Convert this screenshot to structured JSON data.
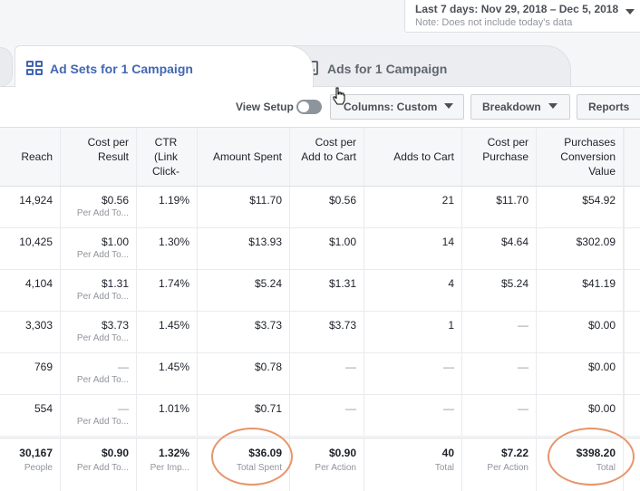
{
  "date_range": {
    "label": "Last 7 days: Nov 29, 2018 – Dec 5, 2018",
    "note": "Note: Does not include today's data"
  },
  "tabs": [
    {
      "label": "Ad Sets for 1 Campaign",
      "icon": "grid-icon",
      "active": true
    },
    {
      "label": "Ads for 1 Campaign",
      "icon": "ad-icon",
      "active": false
    }
  ],
  "toolbar": {
    "view_setup": "View Setup",
    "columns": "Columns: Custom",
    "breakdown": "Breakdown",
    "reports": "Reports"
  },
  "table": {
    "headers": [
      "Reach",
      "Cost per Result",
      "CTR (Link Click-",
      "Amount Spent",
      "Cost per Add to Cart",
      "Adds to Cart",
      "Cost per Purchase",
      "Purchases Conversion Value"
    ],
    "rows": [
      {
        "reach": "14,924",
        "cpr": "$0.56",
        "cpr_sub": "Per Add To...",
        "ctr": "1.19%",
        "spent": "$11.70",
        "cpatc": "$0.56",
        "atc": "21",
        "cpp": "$11.70",
        "pcv": "$54.92"
      },
      {
        "reach": "10,425",
        "cpr": "$1.00",
        "cpr_sub": "Per Add To...",
        "ctr": "1.30%",
        "spent": "$13.93",
        "cpatc": "$1.00",
        "atc": "14",
        "cpp": "$4.64",
        "pcv": "$302.09"
      },
      {
        "reach": "4,104",
        "cpr": "$1.31",
        "cpr_sub": "Per Add To...",
        "ctr": "1.74%",
        "spent": "$5.24",
        "cpatc": "$1.31",
        "atc": "4",
        "cpp": "$5.24",
        "pcv": "$41.19"
      },
      {
        "reach": "3,303",
        "cpr": "$3.73",
        "cpr_sub": "Per Add To...",
        "ctr": "1.45%",
        "spent": "$3.73",
        "cpatc": "$3.73",
        "atc": "1",
        "cpp": "—",
        "pcv": "$0.00"
      },
      {
        "reach": "769",
        "cpr": "—",
        "cpr_sub": "Per Add To...",
        "ctr": "1.45%",
        "spent": "$0.78",
        "cpatc": "—",
        "atc": "—",
        "cpp": "—",
        "pcv": "$0.00"
      },
      {
        "reach": "554",
        "cpr": "—",
        "cpr_sub": "Per Add To...",
        "ctr": "1.01%",
        "spent": "$0.71",
        "cpatc": "—",
        "atc": "—",
        "cpp": "—",
        "pcv": "$0.00"
      }
    ],
    "totals": {
      "reach": "30,167",
      "reach_sub": "People",
      "cpr": "$0.90",
      "cpr_sub": "Per Add To...",
      "ctr": "1.32%",
      "ctr_sub": "Per Imp...",
      "spent": "$36.09",
      "spent_sub": "Total Spent",
      "cpatc": "$0.90",
      "cpatc_sub": "Per Action",
      "atc": "40",
      "atc_sub": "Total",
      "cpp": "$7.22",
      "cpp_sub": "Per Action",
      "pcv": "$398.20",
      "pcv_sub": "Total"
    }
  },
  "colors": {
    "accent": "#4267b2",
    "highlight_circle": "#e8956a"
  }
}
